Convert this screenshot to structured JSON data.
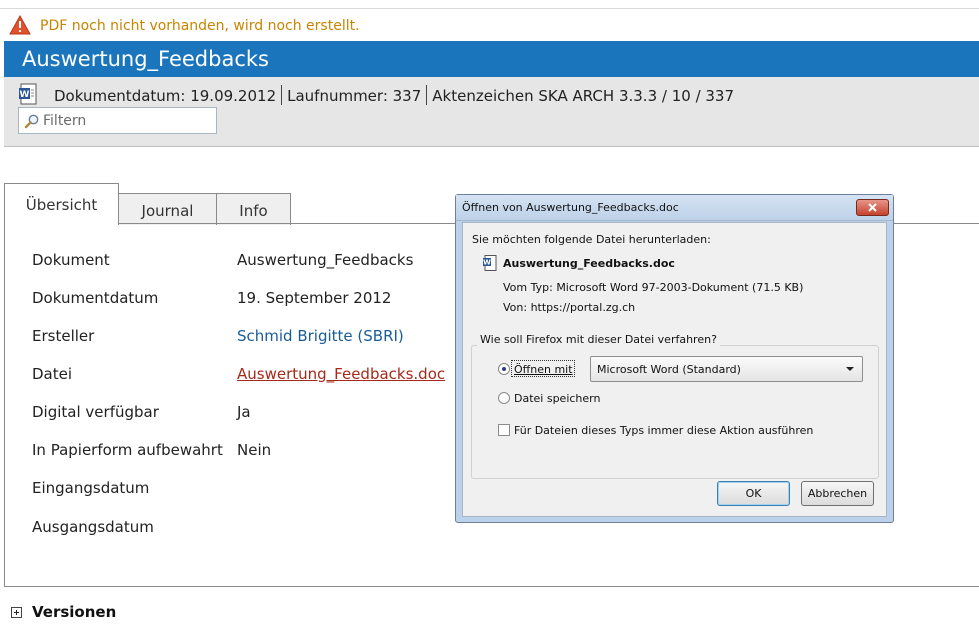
{
  "warning": {
    "text": "PDF noch nicht vorhanden, wird noch erstellt.",
    "icon": "warning-icon",
    "color": "#c98400"
  },
  "header": {
    "title": "Auswertung_Feedbacks",
    "background": "#1a75bd"
  },
  "meta": {
    "doc_icon": "word-document-icon",
    "dokumentdatum": "Dokumentdatum: 19.09.2012",
    "laufnummer": "Laufnummer: 337",
    "aktenzeichen": "Aktenzeichen SKA ARCH 3.3.3 / 10 / 337"
  },
  "filter": {
    "placeholder": "Filtern",
    "icon": "search-icon"
  },
  "tabs": [
    {
      "label": "Übersicht",
      "active": true
    },
    {
      "label": "Journal",
      "active": false
    },
    {
      "label": "Info",
      "active": false
    }
  ],
  "properties": [
    {
      "label": "Dokument",
      "value": "Auswertung_Feedbacks"
    },
    {
      "label": "Dokumentdatum",
      "value": "19. September 2012"
    },
    {
      "label": "Ersteller",
      "value": "Schmid Brigitte (SBRI)"
    },
    {
      "label": "Datei",
      "value": "Auswertung_Feedbacks.doc"
    },
    {
      "label": "Digital verfügbar",
      "value": "Ja"
    },
    {
      "label": "In Papierform aufbewahrt",
      "value": "Nein"
    },
    {
      "label": "Eingangsdatum",
      "value": ""
    },
    {
      "label": "Ausgangsdatum",
      "value": ""
    }
  ],
  "versions": {
    "label": "Versionen",
    "icon": "expand-plus-icon"
  },
  "dialog": {
    "title": "Öffnen von Auswertung_Feedbacks.doc",
    "intro": "Sie möchten folgende Datei herunterladen:",
    "file_name": "Auswertung_Feedbacks.doc",
    "file_type": "Vom Typ:  Microsoft Word 97-2003-Dokument (71.5 KB)",
    "source": "Von:  https://portal.zg.ch",
    "group_label": "Wie soll Firefox mit dieser Datei verfahren?",
    "open_with_label": "Öffnen mit",
    "open_with_selected": "Microsoft Word (Standard)",
    "save_label": "Datei speichern",
    "remember_label": "Für Dateien dieses Typs immer diese Aktion ausführen",
    "ok_label": "OK",
    "cancel_label": "Abbrechen"
  }
}
